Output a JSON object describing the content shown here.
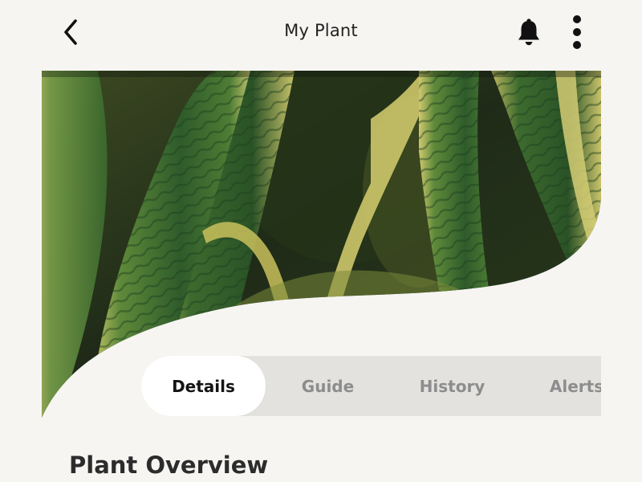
{
  "header": {
    "title": "My Plant",
    "back_icon": "chevron-left-icon",
    "notification_icon": "bell-icon",
    "menu_icon": "more-vertical-icon"
  },
  "hero": {
    "image_subject": "snake plant leaves close-up",
    "colors": {
      "leaf_dark": "#2f5a2b",
      "leaf_light": "#c8c46a",
      "background": "#1f2d1a"
    }
  },
  "tabs": [
    {
      "label": "Details",
      "active": true
    },
    {
      "label": "Guide",
      "active": false
    },
    {
      "label": "History",
      "active": false
    },
    {
      "label": "Alerts",
      "active": false
    }
  ],
  "content": {
    "section_title": "Plant Overview"
  },
  "theme": {
    "background": "#f6f5f2",
    "tab_bar_bg": "#e3e2df",
    "tab_active_bg": "#ffffff",
    "tab_active_text": "#141414",
    "tab_inactive_text": "#8d8d8d"
  }
}
